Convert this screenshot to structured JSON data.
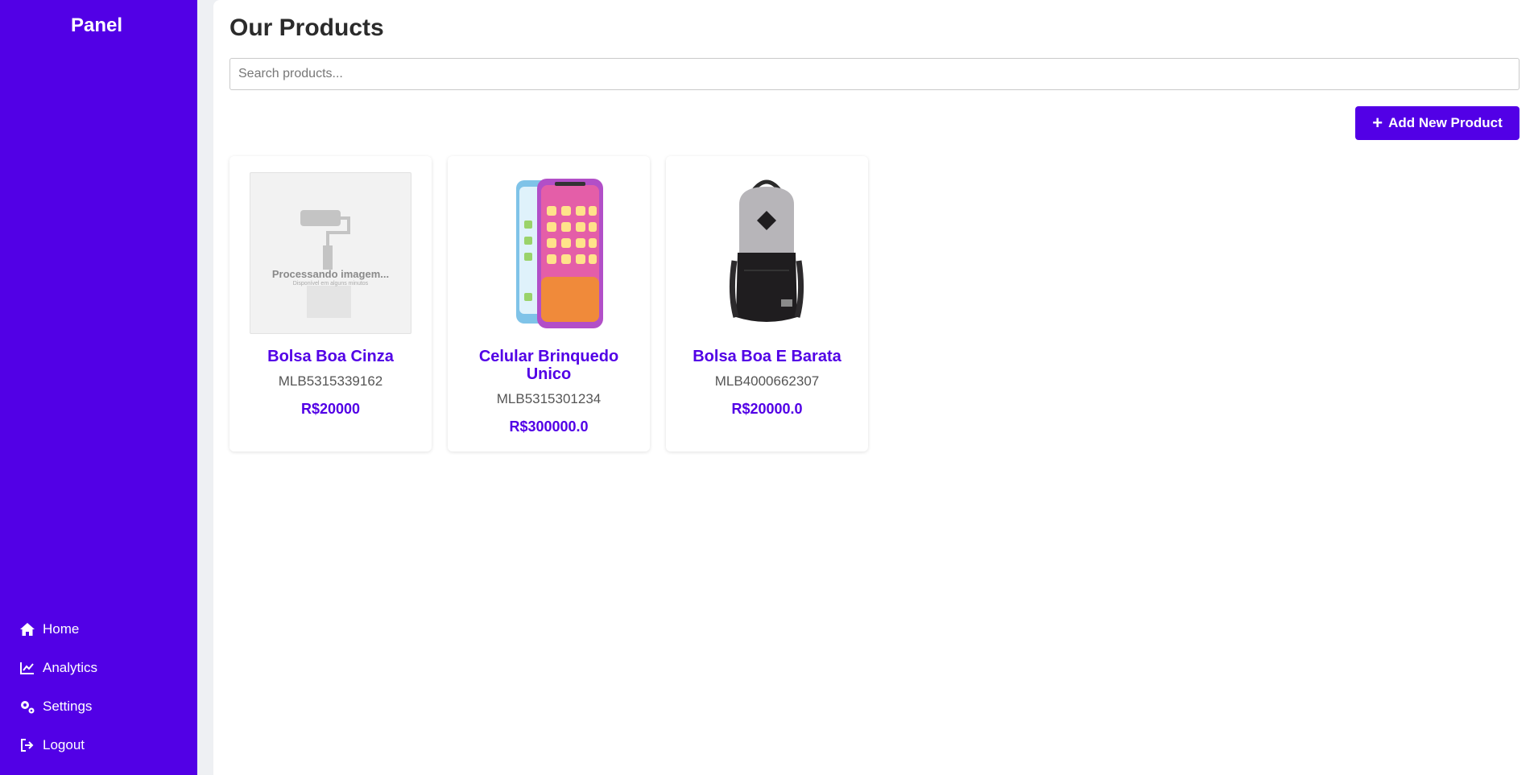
{
  "sidebar": {
    "brand": "Panel",
    "nav": [
      {
        "label": "Home",
        "icon": "home-icon"
      },
      {
        "label": "Analytics",
        "icon": "chart-line-icon"
      },
      {
        "label": "Settings",
        "icon": "gears-icon"
      },
      {
        "label": "Logout",
        "icon": "sign-out-icon"
      }
    ]
  },
  "main": {
    "title": "Our Products",
    "search_placeholder": "Search products...",
    "add_button_label": "Add New Product"
  },
  "products": [
    {
      "name": "Bolsa Boa Cinza",
      "sku": "MLB5315339162",
      "price": "R$20000",
      "image": "processing-placeholder-image",
      "processing_text": "Processando imagem...",
      "processing_subtext": "Disponível em alguns minutos"
    },
    {
      "name": "Celular Brinquedo Unico",
      "sku": "MLB5315301234",
      "price": "R$300000.0",
      "image": "toy-phone-image"
    },
    {
      "name": "Bolsa Boa E Barata",
      "sku": "MLB4000662307",
      "price": "R$20000.0",
      "image": "backpack-image"
    }
  ],
  "colors": {
    "brand": "#5200e6",
    "background": "#ffffff",
    "text": "#333333"
  }
}
